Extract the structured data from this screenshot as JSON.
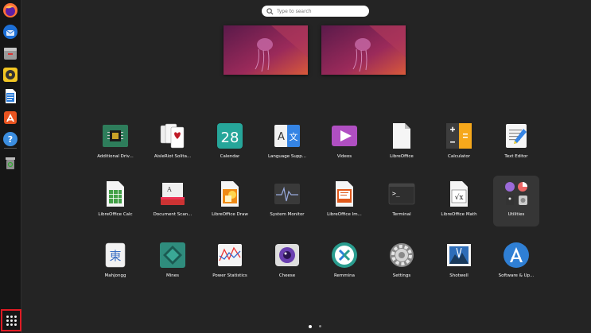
{
  "search": {
    "placeholder": "Type to search"
  },
  "dock": {
    "items": [
      "firefox-icon",
      "thunderbird-icon",
      "files-icon",
      "rhythmbox-icon",
      "writer-icon",
      "software-icon",
      "help-icon",
      "trash-icon"
    ]
  },
  "apps": [
    {
      "label": "Additional Driv...",
      "icon": "additional-drivers-icon"
    },
    {
      "label": "AisleRiot Solita...",
      "icon": "aisleriot-icon"
    },
    {
      "label": "Calendar",
      "icon": "calendar-icon",
      "text": "28"
    },
    {
      "label": "Language Supp...",
      "icon": "language-support-icon",
      "text_a": "A",
      "text_b": "文"
    },
    {
      "label": "Videos",
      "icon": "videos-icon"
    },
    {
      "label": "LibreOffice",
      "icon": "libreoffice-icon"
    },
    {
      "label": "Calculator",
      "icon": "calculator-icon"
    },
    {
      "label": "Text Editor",
      "icon": "text-editor-icon"
    },
    {
      "label": "LibreOffice Calc",
      "icon": "libreoffice-calc-icon"
    },
    {
      "label": "Document Scan...",
      "icon": "document-scanner-icon"
    },
    {
      "label": "LibreOffice Draw",
      "icon": "libreoffice-draw-icon"
    },
    {
      "label": "System Monitor",
      "icon": "system-monitor-icon"
    },
    {
      "label": "LibreOffice Im...",
      "icon": "libreoffice-impress-icon"
    },
    {
      "label": "Terminal",
      "icon": "terminal-icon",
      "text": ">_"
    },
    {
      "label": "LibreOffice Math",
      "icon": "libreoffice-math-icon",
      "text": "√x"
    },
    {
      "label": "Utilities",
      "icon": "utilities-folder-icon"
    },
    {
      "label": "Mahjongg",
      "icon": "mahjongg-icon",
      "text": "東"
    },
    {
      "label": "Mines",
      "icon": "mines-icon"
    },
    {
      "label": "Power Statistics",
      "icon": "power-statistics-icon"
    },
    {
      "label": "Cheese",
      "icon": "cheese-icon"
    },
    {
      "label": "Remmina",
      "icon": "remmina-icon"
    },
    {
      "label": "Settings",
      "icon": "settings-icon"
    },
    {
      "label": "Shotwell",
      "icon": "shotwell-icon"
    },
    {
      "label": "Software & Up...",
      "icon": "software-updates-icon"
    }
  ],
  "pagination": {
    "current": 1,
    "total": 2
  },
  "colors": {
    "background": "#242424",
    "highlight": "#e01b24"
  }
}
